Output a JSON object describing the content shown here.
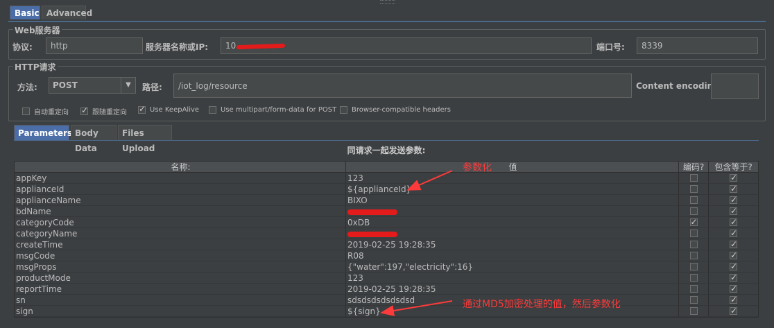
{
  "tabs": {
    "basic": "Basic",
    "advanced": "Advanced"
  },
  "web_server": {
    "title": "Web服务器",
    "protocol_label": "协议:",
    "protocol_value": "http",
    "server_label": "服务器名称或IP:",
    "server_value": "10",
    "port_label": "端口号:",
    "port_value": "8339"
  },
  "http_request": {
    "title": "HTTP请求",
    "method_label": "方法:",
    "method_value": "POST",
    "path_label": "路径:",
    "path_value": "/iot_log/resource",
    "encoding_label": "Content encoding:",
    "encoding_value": ""
  },
  "options": [
    {
      "label": "自动重定向",
      "checked": false
    },
    {
      "label": "跟随重定向",
      "checked": true
    },
    {
      "label": "Use KeepAlive",
      "checked": true
    },
    {
      "label": "Use multipart/form-data for POST",
      "checked": false
    },
    {
      "label": "Browser-compatible headers",
      "checked": false
    }
  ],
  "inner_tabs": {
    "parameters": "Parameters",
    "body_data": "Body Data",
    "files_upload": "Files Upload"
  },
  "table": {
    "title": "同请求一起发送参数:",
    "headers": {
      "name": "名称:",
      "value": "值",
      "encode": "编码?",
      "include_equals": "包含等于?"
    },
    "rows": [
      {
        "name": "appKey",
        "value": "123",
        "encode": false,
        "include": true
      },
      {
        "name": "applianceId",
        "value": "${applianceId}",
        "encode": false,
        "include": true
      },
      {
        "name": "applianceName",
        "value": "BIXO",
        "encode": false,
        "include": true
      },
      {
        "name": "bdName",
        "value": "",
        "redacted": true,
        "encode": false,
        "include": true
      },
      {
        "name": "categoryCode",
        "value": "0xDB",
        "encode": true,
        "include": true
      },
      {
        "name": "categoryName",
        "value": "",
        "redacted": true,
        "encode": false,
        "include": true
      },
      {
        "name": "createTime",
        "value": "2019-02-25 19:28:35",
        "encode": false,
        "include": true
      },
      {
        "name": "msgCode",
        "value": "R08",
        "encode": false,
        "include": true
      },
      {
        "name": "msgProps",
        "value": "{\"water\":197,\"electricity\":16}",
        "encode": false,
        "include": true
      },
      {
        "name": "productMode",
        "value": "123",
        "encode": false,
        "include": true
      },
      {
        "name": "reportTime",
        "value": "2019-02-25 19:28:35",
        "encode": false,
        "include": true
      },
      {
        "name": "sn",
        "value": "sdsdsdsdsdsdsd",
        "encode": false,
        "include": true
      },
      {
        "name": "sign",
        "value": "${sign}",
        "encode": false,
        "include": true
      }
    ]
  },
  "annotations": {
    "parametrize": "参数化",
    "md5_note": "通过MD5加密处理的值，然后参数化",
    "color": "#ff3a3a"
  }
}
